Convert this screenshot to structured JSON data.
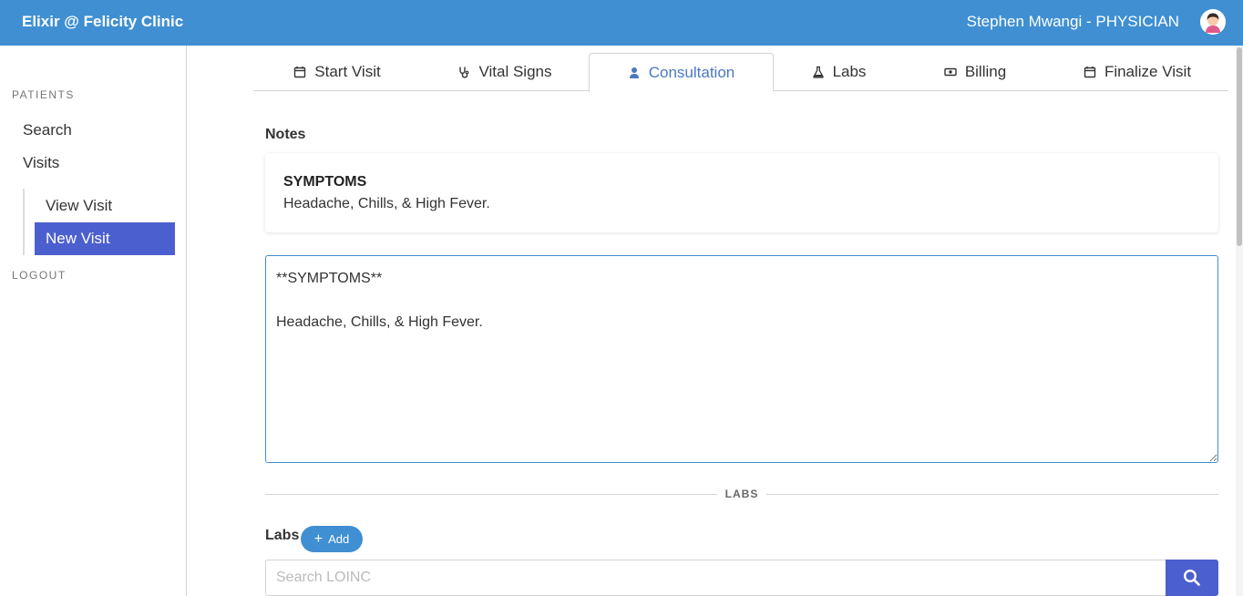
{
  "header": {
    "brand": "Elixir @ Felicity Clinic",
    "user": "Stephen Mwangi - PHYSICIAN",
    "color": "#3f8fd2"
  },
  "sidebar": {
    "section": "PATIENTS",
    "items": [
      {
        "label": "Search"
      },
      {
        "label": "Visits"
      }
    ],
    "subitems": [
      {
        "label": "View Visit"
      },
      {
        "label": "New Visit",
        "active": true
      }
    ],
    "logout": "LOGOUT"
  },
  "tabs": [
    {
      "label": "Start Visit",
      "icon": "calendar-icon"
    },
    {
      "label": "Vital Signs",
      "icon": "stethoscope-icon"
    },
    {
      "label": "Consultation",
      "icon": "doctor-icon",
      "active": true
    },
    {
      "label": "Labs",
      "icon": "flask-icon"
    },
    {
      "label": "Billing",
      "icon": "money-icon"
    },
    {
      "label": "Finalize Visit",
      "icon": "calendar-check-icon"
    }
  ],
  "notes": {
    "title": "Notes",
    "preview_heading": "SYMPTOMS",
    "preview_text": "Headache, Chills, & High Fever.",
    "editor_value": "**SYMPTOMS**\n\nHeadache, Chills, & High Fever."
  },
  "labs": {
    "divider": "LABS",
    "title": "Labs",
    "add_label": "Add",
    "search_placeholder": "Search LOINC"
  },
  "colors": {
    "primary": "#3f8fd2",
    "active": "#4c5fce",
    "tab_active_text": "#4a78c2"
  }
}
